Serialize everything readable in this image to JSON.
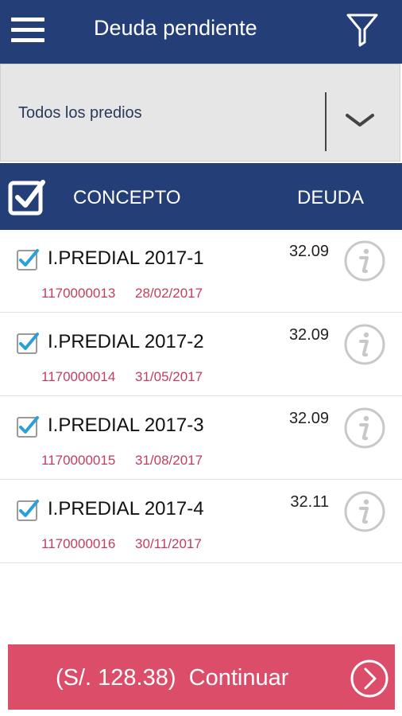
{
  "header": {
    "title": "Deuda pendiente",
    "menu_icon": "hamburger-menu-icon",
    "filter_icon": "filter-funnel-icon"
  },
  "selector": {
    "value": "Todos los predios",
    "icon": "chevron-down-icon"
  },
  "table": {
    "col_concept": "CONCEPTO",
    "col_debt": "DEUDA",
    "rows": [
      {
        "concept": "I.PREDIAL 2017-1",
        "amount": "32.09",
        "code": "1170000013",
        "date": "28/02/2017",
        "checked": true
      },
      {
        "concept": "I.PREDIAL 2017-2",
        "amount": "32.09",
        "code": "1170000014",
        "date": "31/05/2017",
        "checked": true
      },
      {
        "concept": "I.PREDIAL 2017-3",
        "amount": "32.09",
        "code": "1170000015",
        "date": "31/08/2017",
        "checked": true
      },
      {
        "concept": "I.PREDIAL 2017-4",
        "amount": "32.11",
        "code": "1170000016",
        "date": "30/11/2017",
        "checked": true
      }
    ]
  },
  "footer": {
    "button_label": "(S/. 128.38)  Continuar",
    "arrow_icon": "arrow-right-circle-icon"
  },
  "colors": {
    "primary": "#243f78",
    "accent": "#dc4d6a",
    "check": "#2a9fd8",
    "subtext": "#c23e5f"
  }
}
